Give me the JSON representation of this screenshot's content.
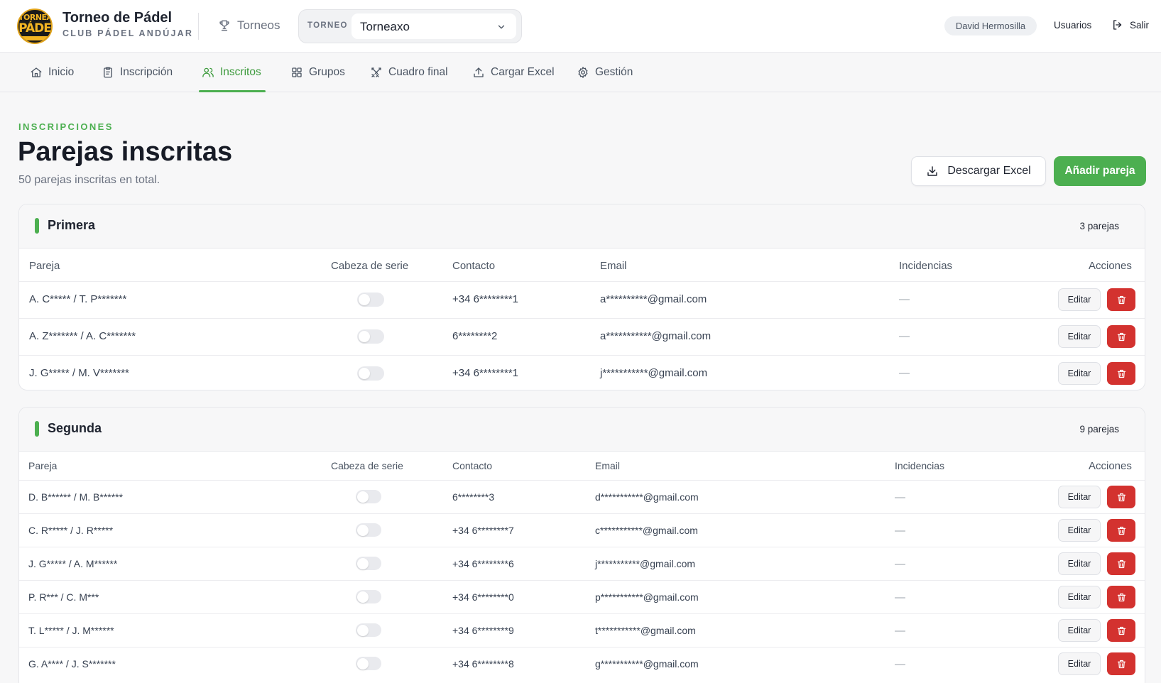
{
  "header": {
    "logo_text_top": "TORNEA",
    "logo_text_main": "PÁDE",
    "title": "Torneo de Pádel",
    "subtitle": "CLUB PÁDEL ANDÚJAR",
    "torneos_label": "Torneos",
    "selector_label": "TORNEO",
    "selector_value": "Torneaxo",
    "user_name": "David Hermosilla",
    "usuarios_label": "Usuarios",
    "salir_label": "Salir"
  },
  "nav": {
    "items": [
      {
        "label": "Inicio",
        "icon": "home-icon"
      },
      {
        "label": "Inscripción",
        "icon": "clipboard-icon"
      },
      {
        "label": "Inscritos",
        "icon": "users-icon"
      },
      {
        "label": "Grupos",
        "icon": "grid-icon"
      },
      {
        "label": "Cuadro final",
        "icon": "swords-icon"
      },
      {
        "label": "Cargar Excel",
        "icon": "upload-icon"
      },
      {
        "label": "Gestión",
        "icon": "gear-icon"
      }
    ],
    "active": "Inscritos"
  },
  "page": {
    "eyebrow": "INSCRIPCIONES",
    "title": "Parejas inscritas",
    "subtitle": "50 parejas inscritas en total.",
    "download_label": "Descargar Excel",
    "add_label": "Añadir pareja"
  },
  "columns": [
    "Pareja",
    "Cabeza de serie",
    "Contacto",
    "Email",
    "Incidencias",
    "Acciones"
  ],
  "edit_label": "Editar",
  "empty_value": "—",
  "accent_color": "#4caf50",
  "danger_color": "#d3322f",
  "categories": [
    {
      "name": "Primera",
      "count": "3 parejas",
      "rows": [
        {
          "pareja": "A. C***** / T. P*******",
          "seeded": false,
          "contacto": "+34 6********1",
          "email": "a**********@gmail.com",
          "incidencias": "—"
        },
        {
          "pareja": "A. Z******* / A. C*******",
          "seeded": false,
          "contacto": "6********2",
          "email": "a***********@gmail.com",
          "incidencias": "—"
        },
        {
          "pareja": "J. G***** / M. V*******",
          "seeded": false,
          "contacto": "+34 6********1",
          "email": "j***********@gmail.com",
          "incidencias": "—"
        }
      ]
    },
    {
      "name": "Segunda",
      "count": "9 parejas",
      "rows": [
        {
          "pareja": "D. B****** / M. B******",
          "seeded": false,
          "contacto": "6********3",
          "email": "d***********@gmail.com",
          "incidencias": "—"
        },
        {
          "pareja": "C. R***** / J. R*****",
          "seeded": false,
          "contacto": "+34 6********7",
          "email": "c***********@gmail.com",
          "incidencias": "—"
        },
        {
          "pareja": "J. G***** / A. M******",
          "seeded": false,
          "contacto": "+34 6********6",
          "email": "j***********@gmail.com",
          "incidencias": "—"
        },
        {
          "pareja": "P. R*** / C. M***",
          "seeded": false,
          "contacto": "+34 6********0",
          "email": "p***********@gmail.com",
          "incidencias": "—"
        },
        {
          "pareja": "T. L***** / J. M******",
          "seeded": false,
          "contacto": "+34 6********9",
          "email": "t***********@gmail.com",
          "incidencias": "—"
        },
        {
          "pareja": "G. A**** / J. S*******",
          "seeded": false,
          "contacto": "+34 6********8",
          "email": "g***********@gmail.com",
          "incidencias": "—"
        }
      ]
    }
  ]
}
